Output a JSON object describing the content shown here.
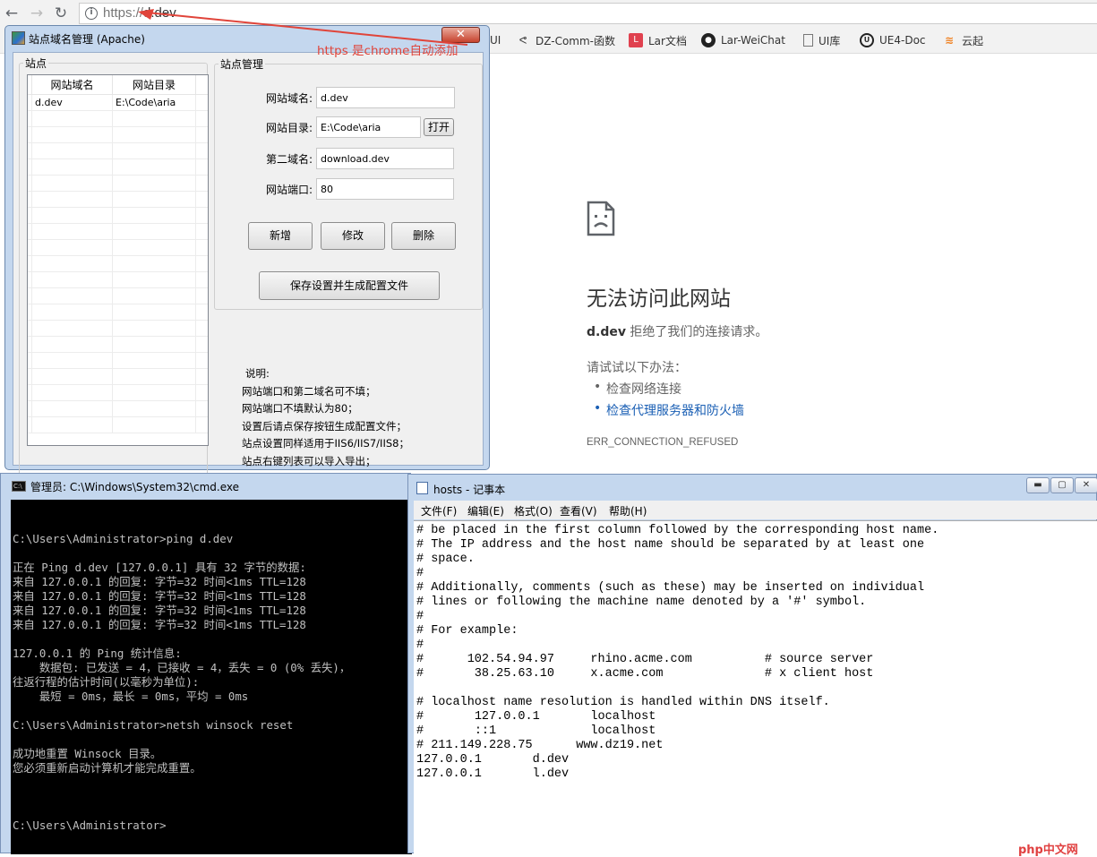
{
  "browser": {
    "url_scheme": "https://",
    "url_host": "d.dev",
    "bookmarks": [
      {
        "label": "UI",
        "icon": "bookmark-icon"
      },
      {
        "label": "DZ-Comm-函数",
        "icon": "feather-icon"
      },
      {
        "label": "Lar文档",
        "icon": "laravel-icon"
      },
      {
        "label": "Lar-WeiChat",
        "icon": "github-icon"
      },
      {
        "label": "UI库",
        "icon": "page-icon"
      },
      {
        "label": "UE4-Doc",
        "icon": "unreal-icon"
      },
      {
        "label": "云起",
        "icon": "cloud-icon"
      }
    ],
    "error": {
      "title": "无法访问此网站",
      "host": "d.dev",
      "desc_suffix": " 拒绝了我们的连接请求。",
      "try_heading": "请试试以下办法：",
      "suggestions": [
        "检查网络连接",
        "检查代理服务器和防火墙"
      ],
      "code": "ERR_CONNECTION_REFUSED"
    }
  },
  "annotation": "https 是chrome自动添加",
  "site_manager": {
    "title": "站点域名管理 (Apache)",
    "close_label": "✕",
    "sites_group": "站点",
    "manage_group": "站点管理",
    "table": {
      "headers": [
        "网站域名",
        "网站目录"
      ],
      "rows": [
        [
          "d.dev",
          "E:\\Code\\aria"
        ]
      ]
    },
    "fields": {
      "domain": {
        "label": "网站域名:",
        "value": "d.dev"
      },
      "dir": {
        "label": "网站目录:",
        "value": "E:\\Code\\aria"
      },
      "second": {
        "label": "第二域名:",
        "value": "download.dev"
      },
      "port": {
        "label": "网站端口:",
        "value": "80"
      }
    },
    "buttons": {
      "open": "打开",
      "add": "新增",
      "edit": "修改",
      "delete": "删除",
      "save": "保存设置并生成配置文件"
    },
    "notes": [
      "说明:",
      "网站端口和第二域名可不填；",
      "网站端口不填默认为80；",
      "设置后请点保存按钮生成配置文件；",
      "站点设置同样适用于IIS6/IIS7/IIS8；",
      "站点右键列表可以导入导出；"
    ]
  },
  "cmd": {
    "title": "管理员: C:\\Windows\\System32\\cmd.exe",
    "lines": [
      "",
      "",
      "C:\\Users\\Administrator>ping d.dev",
      "",
      "正在 Ping d.dev [127.0.0.1] 具有 32 字节的数据:",
      "来自 127.0.0.1 的回复: 字节=32 时间<1ms TTL=128",
      "来自 127.0.0.1 的回复: 字节=32 时间<1ms TTL=128",
      "来自 127.0.0.1 的回复: 字节=32 时间<1ms TTL=128",
      "来自 127.0.0.1 的回复: 字节=32 时间<1ms TTL=128",
      "",
      "127.0.0.1 的 Ping 统计信息:",
      "    数据包: 已发送 = 4，已接收 = 4，丢失 = 0 (0% 丢失)，",
      "往返行程的估计时间(以毫秒为单位):",
      "    最短 = 0ms，最长 = 0ms，平均 = 0ms",
      "",
      "C:\\Users\\Administrator>netsh winsock reset",
      "",
      "成功地重置 Winsock 目录。",
      "您必须重新启动计算机才能完成重置。",
      "",
      "",
      "",
      "C:\\Users\\Administrator>"
    ]
  },
  "notepad": {
    "title": "hosts - 记事本",
    "menu": [
      "文件(F)",
      "编辑(E)",
      "格式(O)",
      "查看(V)",
      "帮助(H)"
    ],
    "lines": [
      "# be placed in the first column followed by the corresponding host name.",
      "# The IP address and the host name should be separated by at least one",
      "# space.",
      "#",
      "# Additionally, comments (such as these) may be inserted on individual",
      "# lines or following the machine name denoted by a '#' symbol.",
      "#",
      "# For example:",
      "#",
      "#      102.54.94.97     rhino.acme.com          # source server",
      "#       38.25.63.10     x.acme.com              # x client host",
      "",
      "# localhost name resolution is handled within DNS itself.",
      "#\t127.0.0.1       localhost",
      "#\t::1             localhost",
      "# 211.149.228.75      www.dz19.net",
      "127.0.0.1\td.dev",
      "127.0.0.1\tl.dev"
    ]
  },
  "watermark": "php中文网"
}
